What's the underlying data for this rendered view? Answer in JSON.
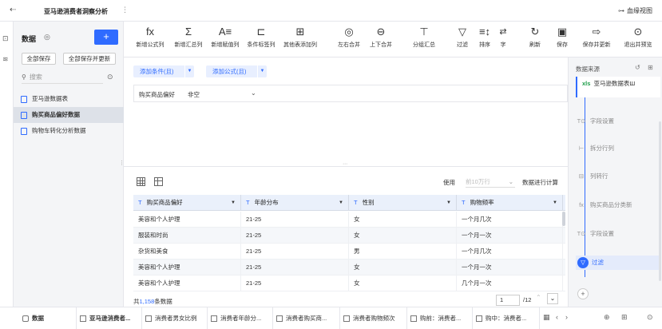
{
  "topbar": {
    "back_icon": "exit-icon",
    "title": "亚马逊消费者洞察分析",
    "more_icon": "dots-icon",
    "lineage_label": "血缘视图"
  },
  "left_panel": {
    "heading": "数据",
    "add_label": "+",
    "save_all": "全部保存",
    "save_all_update": "全部保存并更新",
    "search_placeholder": "搜索",
    "items": [
      {
        "label": "亚马逊数据表"
      },
      {
        "label": "购买商品偏好数据"
      },
      {
        "label": "购物车转化分析数据"
      }
    ]
  },
  "toolbar": {
    "items": [
      {
        "glyph": "fx",
        "label": "新增公式列"
      },
      {
        "glyph": "Σ",
        "label": "新增汇总列"
      },
      {
        "glyph": "A≡",
        "label": "新增赋值列"
      },
      {
        "glyph": "⊏",
        "label": "条件标签列"
      },
      {
        "glyph": "⊞",
        "label": "其他表添加列"
      },
      {
        "glyph": "◎",
        "label": "左右合并"
      },
      {
        "glyph": "⊖",
        "label": "上下合并"
      },
      {
        "glyph": "⊤",
        "label": "分组汇总"
      },
      {
        "glyph": "▽",
        "label": "过滤"
      },
      {
        "glyph": "≡↕",
        "label": "排序"
      },
      {
        "glyph": "⇄",
        "label": "字"
      },
      {
        "glyph": "↻",
        "label": "刷新"
      },
      {
        "glyph": "▣",
        "label": "保存"
      },
      {
        "glyph": "⇨",
        "label": "保存并更新"
      },
      {
        "glyph": "⊙",
        "label": "退出并预览"
      }
    ]
  },
  "conditions": {
    "add_condition": "添加条件(且)",
    "add_formula": "添加公式(且)",
    "filter": {
      "field": "购买商品偏好",
      "value": "非空"
    }
  },
  "table_controls": {
    "use_label": "使用",
    "use_value": "前10万行",
    "use_tail": "数据进行计算"
  },
  "table": {
    "columns": [
      {
        "type": "T",
        "name": "购买商品偏好"
      },
      {
        "type": "T",
        "name": "年龄分布"
      },
      {
        "type": "T",
        "name": "性别"
      },
      {
        "type": "T",
        "name": "购物频率"
      }
    ],
    "rows": [
      [
        "美容和个人护理",
        "21-25",
        "女",
        "一个月几次"
      ],
      [
        "服装和时尚",
        "21-25",
        "女",
        "一个月一次"
      ],
      [
        "杂货和美食",
        "21-25",
        "男",
        "一个月几次"
      ],
      [
        "美容和个人护理",
        "21-25",
        "女",
        "一个月一次"
      ],
      [
        "美容和个人护理",
        "21-25",
        "女",
        "几个月一次"
      ]
    ]
  },
  "footer": {
    "total_prefix": "共",
    "total_count": "1,158",
    "total_suffix": "条数据",
    "page": "1",
    "page_total": "/12"
  },
  "right_panel": {
    "title": "数据来源",
    "source": "亚马逊数据表Ш",
    "steps": [
      {
        "icon": "T⊙",
        "label": "字段设置"
      },
      {
        "icon": "⊢",
        "label": "拆分行列"
      },
      {
        "icon": "⊟",
        "label": "列转行"
      },
      {
        "icon": "fx",
        "label": "购买商品分类新"
      },
      {
        "icon": "T⊙",
        "label": "字段设置"
      },
      {
        "icon": "▽",
        "label": "过滤"
      }
    ]
  },
  "bottom_tabs": {
    "data_tab": "数据",
    "tabs": [
      "亚马逊消费者...",
      "消费者男女比例",
      "消费者年龄分...",
      "消费者购买商...",
      "消费者购物频次",
      "购前：消费者...",
      "购中：消费者..."
    ]
  },
  "colors": {
    "accent": "#2f6bff",
    "header_bg": "#eaf0fb",
    "panel_bg": "#f4f5f7"
  }
}
